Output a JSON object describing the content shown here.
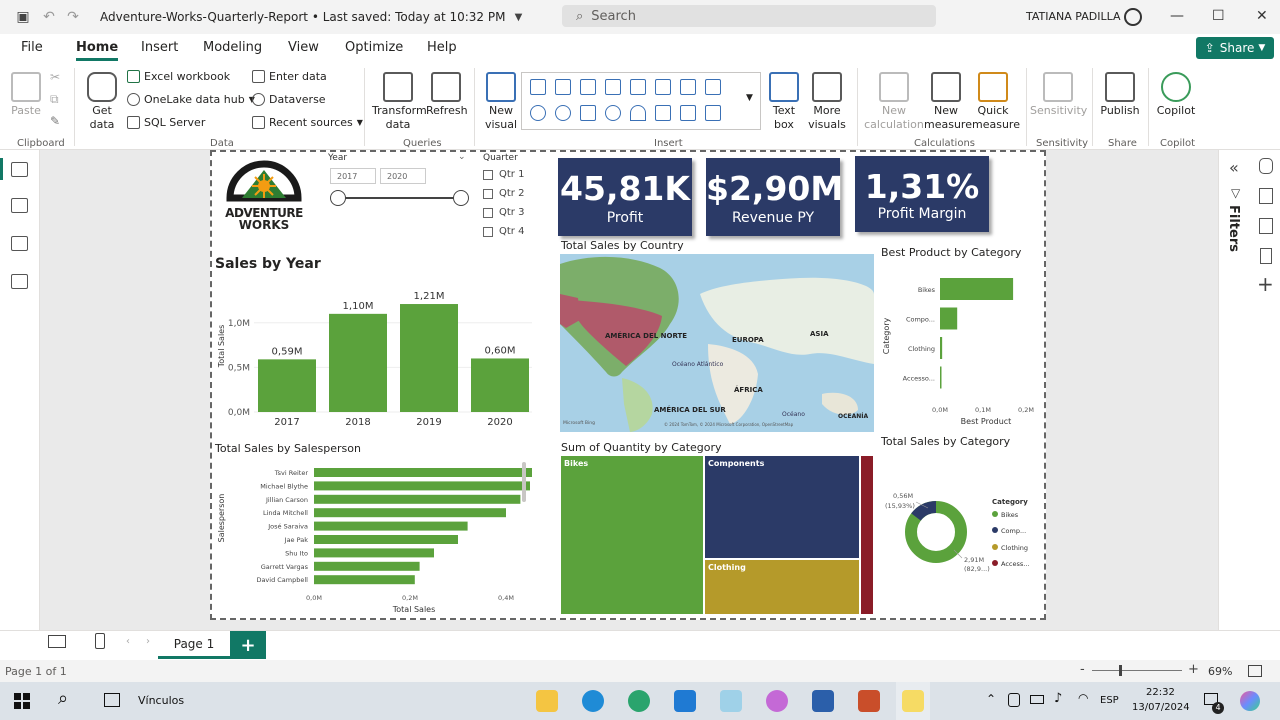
{
  "titlebar": {
    "title": "Adventure-Works-Quarterly-Report • Last saved: Today at 10:32 PM",
    "search_placeholder": "Search",
    "user": "TATIANA PADILLA"
  },
  "menu": {
    "tabs": [
      "File",
      "Home",
      "Insert",
      "Modeling",
      "View",
      "Optimize",
      "Help"
    ],
    "active": "Home",
    "share": "Share"
  },
  "ribbon": {
    "paste": "Paste",
    "clipboard": "Clipboard",
    "get_data": "Get data",
    "excel": "Excel workbook",
    "onelake": "OneLake data hub",
    "sql": "SQL Server",
    "data": "Data",
    "enter_data": "Enter data",
    "dataverse": "Dataverse",
    "recent": "Recent sources",
    "transform": "Transform data",
    "refresh": "Refresh",
    "queries": "Queries",
    "new_visual": "New visual",
    "insert": "Insert",
    "text_box": "Text box",
    "more_visuals": "More visuals",
    "new_calc": "New calculation",
    "new_measure": "New measure",
    "quick_measure": "Quick measure",
    "calculations": "Calculations",
    "sensitivity": "Sensitivity",
    "sensitivity_grp": "Sensitivity",
    "publish": "Publish",
    "share_grp": "Share",
    "copilot": "Copilot",
    "copilot_grp": "Copilot"
  },
  "rightrail": {
    "filters": "Filters"
  },
  "report": {
    "logo_line1": "Adventure",
    "logo_line2": "Works",
    "year_slicer": {
      "title": "Year",
      "from": "2017",
      "to": "2020"
    },
    "quarter_slicer": {
      "title": "Quarter",
      "items": [
        "Qtr 1",
        "Qtr 2",
        "Qtr 3",
        "Qtr 4"
      ]
    },
    "kpis": [
      {
        "value": "45,81K",
        "label": "Profit"
      },
      {
        "value": "$2,90M",
        "label": "Revenue PY"
      },
      {
        "value": "1,31%",
        "label": "Profit Margin"
      }
    ],
    "map": {
      "title": "Total Sales by Country",
      "labels": [
        "AMÉRICA DEL NORTE",
        "EUROPA",
        "ASIA",
        "Océano Atlántico",
        "ÁFRICA",
        "AMÉRICA DEL SUR",
        "Océano",
        "OCEANÍA"
      ],
      "attribution": "© 2024 TomTom, © 2024 Microsoft Corporation, OpenStreetMap",
      "brand": "Microsoft Bing"
    },
    "treemap": {
      "title": "Sum of Quantity by Category",
      "labels": [
        "Bikes",
        "Components",
        "Clothing"
      ]
    },
    "donut": {
      "title": "Total Sales by Category",
      "legend_title": "Category",
      "legend": [
        "Bikes",
        "Comp...",
        "Clothing",
        "Access..."
      ],
      "label_a": "0,56M",
      "label_a2": "(15,93%)",
      "label_b": "2,91M",
      "label_b2": "(82,9...)"
    }
  },
  "bottombar": {
    "page": "Page 1",
    "add": "+"
  },
  "statusbar": {
    "page_info": "Page 1 of 1",
    "zoom": "69%"
  },
  "taskbar": {
    "search_label": "Vínculos",
    "lang": "ESP",
    "time": "22:32",
    "date": "13/07/2024",
    "badge": "4"
  },
  "chart_data": [
    {
      "type": "bar",
      "title": "Sales by Year",
      "categories": [
        "2017",
        "2018",
        "2019",
        "2020"
      ],
      "values": [
        0.59,
        1.1,
        1.21,
        0.6
      ],
      "data_labels": [
        "0,59M",
        "1,10M",
        "1,21M",
        "0,60M"
      ],
      "ylabel": "Total Sales",
      "yticks": [
        "0,0M",
        "0,5M",
        "1,0M"
      ],
      "ylim": [
        0,
        1.3
      ],
      "color": "#5ba23c"
    },
    {
      "type": "bar",
      "orientation": "horizontal",
      "title": "Total Sales by Salesperson",
      "categories": [
        "Tsvi Reiter",
        "Michael Blythe",
        "Jillian Carson",
        "Linda Mitchell",
        "José Saraiva",
        "Jae Pak",
        "Shu Ito",
        "Garrett Vargas",
        "David Campbell"
      ],
      "values": [
        0.49,
        0.45,
        0.43,
        0.4,
        0.32,
        0.3,
        0.25,
        0.22,
        0.21
      ],
      "xlabel": "Total Sales",
      "ylabel": "Salesperson",
      "xticks": [
        "0,0M",
        "0,2M",
        "0,4M"
      ],
      "xlim": [
        0,
        0.5
      ],
      "color": "#5ba23c"
    },
    {
      "type": "bar",
      "orientation": "horizontal",
      "title": "Best Product by Category",
      "categories": [
        "Bikes",
        "Compo...",
        "Clothing",
        "Accesso..."
      ],
      "values": [
        0.17,
        0.04,
        0.005,
        0.003
      ],
      "xlabel": "Best Product",
      "ylabel": "Category",
      "xticks": [
        "0,0M",
        "0,1M",
        "0,2M"
      ],
      "xlim": [
        0,
        0.2
      ],
      "color": "#5ba23c"
    },
    {
      "type": "pie",
      "title": "Total Sales by Category",
      "categories": [
        "Bikes",
        "Components",
        "Clothing",
        "Accessories"
      ],
      "values": [
        2.91,
        0.56,
        0.02,
        0.01
      ],
      "colors": [
        "#5ba23c",
        "#2b3a67",
        "#b59a2a",
        "#8a1c28"
      ]
    },
    {
      "type": "treemap",
      "title": "Sum of Quantity by Category",
      "categories": [
        "Bikes",
        "Components",
        "Clothing",
        "Accessories"
      ],
      "values": [
        47,
        33,
        17,
        3
      ],
      "colors": [
        "#5ba23c",
        "#2b3a67",
        "#b59a2a",
        "#8a1c28"
      ]
    }
  ]
}
